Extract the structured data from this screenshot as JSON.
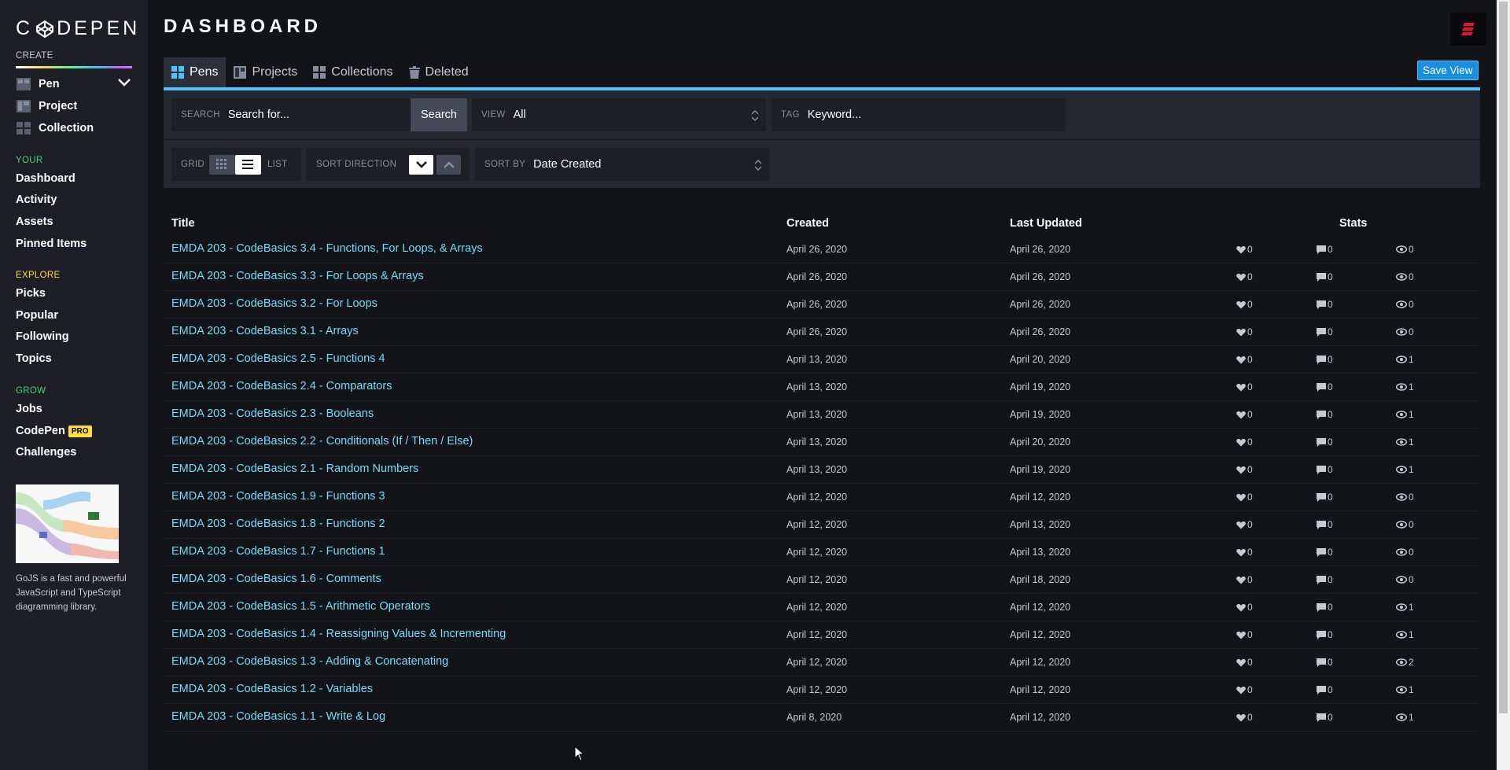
{
  "sidebar": {
    "logo": "CODEPEN",
    "create_label": "CREATE",
    "create_items": [
      "Pen",
      "Project",
      "Collection"
    ],
    "your_label": "YOUR",
    "your_items": [
      "Dashboard",
      "Activity",
      "Assets",
      "Pinned Items"
    ],
    "explore_label": "EXPLORE",
    "explore_items": [
      "Picks",
      "Popular",
      "Following",
      "Topics"
    ],
    "grow_label": "GROW",
    "grow_items": [
      "Jobs",
      "CodePen",
      "Challenges"
    ],
    "pro_badge": "PRO",
    "ad_text": "GoJS is a fast and powerful JavaScript and TypeScript diagramming library."
  },
  "header": {
    "title": "DASHBOARD"
  },
  "tabs": [
    "Pens",
    "Projects",
    "Collections",
    "Deleted"
  ],
  "save_view": "Save View",
  "filters": {
    "search_label": "SEARCH",
    "search_placeholder": "Search for...",
    "search_button": "Search",
    "view_label": "VIEW",
    "view_value": "All",
    "tag_label": "TAG",
    "tag_placeholder": "Keyword...",
    "grid_label": "GRID",
    "list_label": "LIST",
    "sort_direction_label": "SORT DIRECTION",
    "sort_by_label": "SORT BY",
    "sort_by_value": "Date Created"
  },
  "table": {
    "headers": {
      "title": "Title",
      "created": "Created",
      "updated": "Last Updated",
      "stats": "Stats"
    },
    "rows": [
      {
        "title": "EMDA 203 - CodeBasics 3.4 - Functions, For Loops, & Arrays",
        "created": "April 26, 2020",
        "updated": "April 26, 2020",
        "likes": "0",
        "comments": "0",
        "views": "0"
      },
      {
        "title": "EMDA 203 - CodeBasics 3.3 - For Loops & Arrays",
        "created": "April 26, 2020",
        "updated": "April 26, 2020",
        "likes": "0",
        "comments": "0",
        "views": "0"
      },
      {
        "title": "EMDA 203 - CodeBasics 3.2 - For Loops",
        "created": "April 26, 2020",
        "updated": "April 26, 2020",
        "likes": "0",
        "comments": "0",
        "views": "0"
      },
      {
        "title": "EMDA 203 - CodeBasics 3.1 - Arrays",
        "created": "April 26, 2020",
        "updated": "April 26, 2020",
        "likes": "0",
        "comments": "0",
        "views": "0"
      },
      {
        "title": "EMDA 203 - CodeBasics 2.5 - Functions 4",
        "created": "April 13, 2020",
        "updated": "April 20, 2020",
        "likes": "0",
        "comments": "0",
        "views": "1"
      },
      {
        "title": "EMDA 203 - CodeBasics 2.4 - Comparators",
        "created": "April 13, 2020",
        "updated": "April 19, 2020",
        "likes": "0",
        "comments": "0",
        "views": "1"
      },
      {
        "title": "EMDA 203 - CodeBasics 2.3 - Booleans",
        "created": "April 13, 2020",
        "updated": "April 19, 2020",
        "likes": "0",
        "comments": "0",
        "views": "1"
      },
      {
        "title": "EMDA 203 - CodeBasics 2.2 - Conditionals (If / Then / Else)",
        "created": "April 13, 2020",
        "updated": "April 20, 2020",
        "likes": "0",
        "comments": "0",
        "views": "1"
      },
      {
        "title": "EMDA 203 - CodeBasics 2.1 - Random Numbers",
        "created": "April 13, 2020",
        "updated": "April 19, 2020",
        "likes": "0",
        "comments": "0",
        "views": "1"
      },
      {
        "title": "EMDA 203 - CodeBasics 1.9 - Functions 3",
        "created": "April 12, 2020",
        "updated": "April 12, 2020",
        "likes": "0",
        "comments": "0",
        "views": "0"
      },
      {
        "title": "EMDA 203 - CodeBasics 1.8 - Functions 2",
        "created": "April 12, 2020",
        "updated": "April 13, 2020",
        "likes": "0",
        "comments": "0",
        "views": "0"
      },
      {
        "title": "EMDA 203 - CodeBasics 1.7 - Functions 1",
        "created": "April 12, 2020",
        "updated": "April 13, 2020",
        "likes": "0",
        "comments": "0",
        "views": "0"
      },
      {
        "title": "EMDA 203 - CodeBasics 1.6 - Comments",
        "created": "April 12, 2020",
        "updated": "April 18, 2020",
        "likes": "0",
        "comments": "0",
        "views": "0"
      },
      {
        "title": "EMDA 203 - CodeBasics 1.5 - Arithmetic Operators",
        "created": "April 12, 2020",
        "updated": "April 12, 2020",
        "likes": "0",
        "comments": "0",
        "views": "1"
      },
      {
        "title": "EMDA 203 - CodeBasics 1.4 - Reassigning Values & Incrementing",
        "created": "April 12, 2020",
        "updated": "April 12, 2020",
        "likes": "0",
        "comments": "0",
        "views": "1"
      },
      {
        "title": "EMDA 203 - CodeBasics 1.3 - Adding & Concatenating",
        "created": "April 12, 2020",
        "updated": "April 12, 2020",
        "likes": "0",
        "comments": "0",
        "views": "2"
      },
      {
        "title": "EMDA 203 - CodeBasics 1.2 - Variables",
        "created": "April 12, 2020",
        "updated": "April 12, 2020",
        "likes": "0",
        "comments": "0",
        "views": "1"
      },
      {
        "title": "EMDA 203 - CodeBasics 1.1 - Write & Log",
        "created": "April 8, 2020",
        "updated": "April 12, 2020",
        "likes": "0",
        "comments": "0",
        "views": "1"
      }
    ]
  },
  "colors": {
    "accent": "#4fc3f7",
    "link": "#76daff",
    "your": "#47cf73",
    "explore": "#ffdd40"
  }
}
